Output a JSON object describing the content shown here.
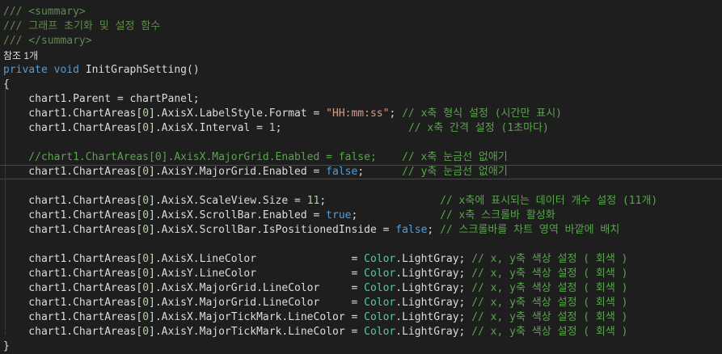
{
  "colors": {
    "background": "#1e1e1e",
    "comment": "#57a64a",
    "keyword": "#569cd6",
    "string": "#d69d85",
    "type": "#4ec9b0",
    "number": "#b5cea8",
    "plain": "#dcdcdc"
  },
  "editor": {
    "lines": [
      {
        "kind": "code",
        "tokens": [
          {
            "c": "doc",
            "t": "/// <summary>"
          }
        ]
      },
      {
        "kind": "code",
        "tokens": [
          {
            "c": "doc",
            "t": "/// 그래프 초기화 및 설정 함수"
          }
        ]
      },
      {
        "kind": "code",
        "tokens": [
          {
            "c": "doc",
            "t": "/// </summary>"
          }
        ]
      },
      {
        "kind": "codelens",
        "tokens": [
          {
            "c": "plain",
            "t": "참조 1개"
          }
        ]
      },
      {
        "kind": "code",
        "tokens": [
          {
            "c": "kw",
            "t": "private"
          },
          {
            "c": "plain",
            "t": " "
          },
          {
            "c": "kw",
            "t": "void"
          },
          {
            "c": "plain",
            "t": " InitGraphSetting()"
          }
        ]
      },
      {
        "kind": "code",
        "tokens": [
          {
            "c": "brace",
            "t": "{"
          }
        ]
      },
      {
        "kind": "code",
        "tokens": [
          {
            "c": "plain",
            "t": "    chart1.Parent = chartPanel;"
          }
        ]
      },
      {
        "kind": "code",
        "tokens": [
          {
            "c": "plain",
            "t": "    chart1.ChartAreas["
          },
          {
            "c": "num",
            "t": "0"
          },
          {
            "c": "plain",
            "t": "].AxisX.LabelStyle.Format = "
          },
          {
            "c": "str",
            "t": "\"HH:mm:ss\""
          },
          {
            "c": "plain",
            "t": "; "
          },
          {
            "c": "comment",
            "t": "// x축 형식 설정 (시간만 표시)"
          }
        ]
      },
      {
        "kind": "code",
        "tokens": [
          {
            "c": "plain",
            "t": "    chart1.ChartAreas["
          },
          {
            "c": "num",
            "t": "0"
          },
          {
            "c": "plain",
            "t": "].AxisX.Interval = "
          },
          {
            "c": "num",
            "t": "1"
          },
          {
            "c": "plain",
            "t": ";                    "
          },
          {
            "c": "comment",
            "t": "// x축 간격 설정 (1초마다)"
          }
        ]
      },
      {
        "kind": "empty",
        "tokens": []
      },
      {
        "kind": "code",
        "tokens": [
          {
            "c": "comment",
            "t": "    //chart1.ChartAreas[0].AxisX.MajorGrid.Enabled = false;    // x축 눈금선 없애기"
          }
        ]
      },
      {
        "kind": "current",
        "tokens": [
          {
            "c": "plain",
            "t": "    chart1.ChartAreas["
          },
          {
            "c": "num",
            "t": "0"
          },
          {
            "c": "plain",
            "t": "].AxisY.MajorGrid.Enabled = "
          },
          {
            "c": "kw",
            "t": "false"
          },
          {
            "c": "plain",
            "t": ";      "
          },
          {
            "c": "comment",
            "t": "// y축 눈금선 없애기"
          }
        ]
      },
      {
        "kind": "empty",
        "tokens": []
      },
      {
        "kind": "code",
        "tokens": [
          {
            "c": "plain",
            "t": "    chart1.ChartAreas["
          },
          {
            "c": "num",
            "t": "0"
          },
          {
            "c": "plain",
            "t": "].AxisX.ScaleView.Size = "
          },
          {
            "c": "num",
            "t": "11"
          },
          {
            "c": "plain",
            "t": ";                  "
          },
          {
            "c": "comment",
            "t": "// x축에 표시되는 데이터 개수 설정 (11개)"
          }
        ]
      },
      {
        "kind": "code",
        "tokens": [
          {
            "c": "plain",
            "t": "    chart1.ChartAreas["
          },
          {
            "c": "num",
            "t": "0"
          },
          {
            "c": "plain",
            "t": "].AxisX.ScrollBar.Enabled = "
          },
          {
            "c": "kw",
            "t": "true"
          },
          {
            "c": "plain",
            "t": ";             "
          },
          {
            "c": "comment",
            "t": "// x축 스크롤바 활성화"
          }
        ]
      },
      {
        "kind": "code",
        "tokens": [
          {
            "c": "plain",
            "t": "    chart1.ChartAreas["
          },
          {
            "c": "num",
            "t": "0"
          },
          {
            "c": "plain",
            "t": "].AxisX.ScrollBar.IsPositionedInside = "
          },
          {
            "c": "kw",
            "t": "false"
          },
          {
            "c": "plain",
            "t": "; "
          },
          {
            "c": "comment",
            "t": "// 스크롤바를 차트 영역 바깥에 배치"
          }
        ]
      },
      {
        "kind": "empty",
        "tokens": []
      },
      {
        "kind": "code",
        "tokens": [
          {
            "c": "plain",
            "t": "    chart1.ChartAreas["
          },
          {
            "c": "num",
            "t": "0"
          },
          {
            "c": "plain",
            "t": "].AxisX.LineColor               = "
          },
          {
            "c": "type",
            "t": "Color"
          },
          {
            "c": "plain",
            "t": ".LightGray; "
          },
          {
            "c": "comment",
            "t": "// x, y축 색상 설정 ( 회색 )"
          }
        ]
      },
      {
        "kind": "code",
        "tokens": [
          {
            "c": "plain",
            "t": "    chart1.ChartAreas["
          },
          {
            "c": "num",
            "t": "0"
          },
          {
            "c": "plain",
            "t": "].AxisY.LineColor               = "
          },
          {
            "c": "type",
            "t": "Color"
          },
          {
            "c": "plain",
            "t": ".LightGray; "
          },
          {
            "c": "comment",
            "t": "// x, y축 색상 설정 ( 회색 )"
          }
        ]
      },
      {
        "kind": "code",
        "tokens": [
          {
            "c": "plain",
            "t": "    chart1.ChartAreas["
          },
          {
            "c": "num",
            "t": "0"
          },
          {
            "c": "plain",
            "t": "].AxisX.MajorGrid.LineColor     = "
          },
          {
            "c": "type",
            "t": "Color"
          },
          {
            "c": "plain",
            "t": ".LightGray; "
          },
          {
            "c": "comment",
            "t": "// x, y축 색상 설정 ( 회색 )"
          }
        ]
      },
      {
        "kind": "code",
        "tokens": [
          {
            "c": "plain",
            "t": "    chart1.ChartAreas["
          },
          {
            "c": "num",
            "t": "0"
          },
          {
            "c": "plain",
            "t": "].AxisY.MajorGrid.LineColor     = "
          },
          {
            "c": "type",
            "t": "Color"
          },
          {
            "c": "plain",
            "t": ".LightGray; "
          },
          {
            "c": "comment",
            "t": "// x, y축 색상 설정 ( 회색 )"
          }
        ]
      },
      {
        "kind": "code",
        "tokens": [
          {
            "c": "plain",
            "t": "    chart1.ChartAreas["
          },
          {
            "c": "num",
            "t": "0"
          },
          {
            "c": "plain",
            "t": "].AxisX.MajorTickMark.LineColor = "
          },
          {
            "c": "type",
            "t": "Color"
          },
          {
            "c": "plain",
            "t": ".LightGray; "
          },
          {
            "c": "comment",
            "t": "// x, y축 색상 설정 ( 회색 )"
          }
        ]
      },
      {
        "kind": "code",
        "tokens": [
          {
            "c": "plain",
            "t": "    chart1.ChartAreas["
          },
          {
            "c": "num",
            "t": "0"
          },
          {
            "c": "plain",
            "t": "].AxisY.MajorTickMark.LineColor = "
          },
          {
            "c": "type",
            "t": "Color"
          },
          {
            "c": "plain",
            "t": ".LightGray; "
          },
          {
            "c": "comment",
            "t": "// x, y축 색상 설정 ( 회색 )"
          }
        ]
      },
      {
        "kind": "code",
        "tokens": [
          {
            "c": "brace",
            "t": "}"
          }
        ]
      }
    ]
  }
}
